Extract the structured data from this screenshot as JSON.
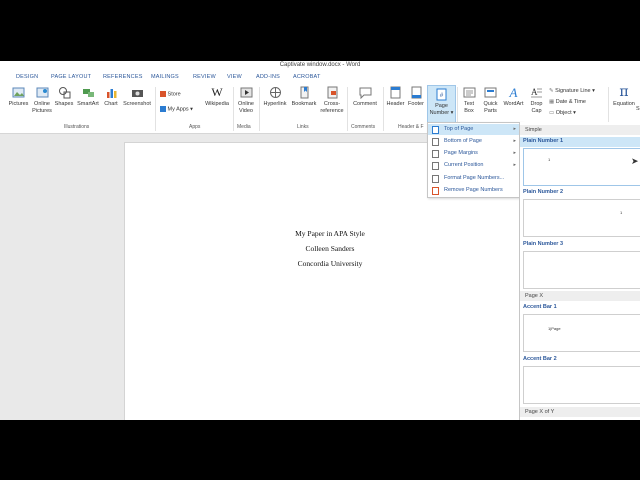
{
  "window": {
    "title": "Captivate window.docx - Word"
  },
  "tabs": [
    "DESIGN",
    "PAGE LAYOUT",
    "REFERENCES",
    "MAILINGS",
    "REVIEW",
    "VIEW",
    "ADD-INS",
    "ACROBAT"
  ],
  "ribbon": {
    "illustrations": {
      "pictures": "Pictures",
      "online_pictures": [
        "Online",
        "Pictures"
      ],
      "shapes": "Shapes",
      "smartart": "SmartArt",
      "chart": "Chart",
      "screenshot": "Screenshot",
      "label": "Illustrations"
    },
    "apps": {
      "store": "Store",
      "my_apps": "My Apps",
      "wikipedia": "Wikipedia",
      "label": "Apps"
    },
    "media": {
      "online_video": [
        "Online",
        "Video"
      ],
      "label": "Media"
    },
    "links": {
      "hyperlink": "Hyperlink",
      "bookmark": "Bookmark",
      "cross_reference": [
        "Cross-",
        "reference"
      ],
      "label": "Links"
    },
    "comments": {
      "comment": "Comment",
      "label": "Comments"
    },
    "header_footer": {
      "header": "Header",
      "footer": "Footer",
      "page_number": [
        "Page",
        "Number"
      ],
      "label": "Header & F"
    },
    "text": {
      "text_box": [
        "Text",
        "Box"
      ],
      "quick_parts": [
        "Quick",
        "Parts"
      ],
      "wordart": "WordArt",
      "drop_cap": [
        "Drop",
        "Cap"
      ],
      "signature_line": "Signature Line",
      "date_time": "Date & Time",
      "object": "Object"
    },
    "symbols": {
      "equation": "Equation",
      "equation_glyph": "π",
      "symbol_partial": "S"
    }
  },
  "page_number_menu": {
    "items": [
      {
        "label": "Top of Page",
        "submenu": true
      },
      {
        "label": "Bottom of Page",
        "submenu": true
      },
      {
        "label": "Page Margins",
        "submenu": true
      },
      {
        "label": "Current Position",
        "submenu": true
      },
      {
        "label": "Format Page Numbers...",
        "submenu": false
      },
      {
        "label": "Remove Page Numbers",
        "submenu": false
      }
    ]
  },
  "gallery": {
    "section_simple": "Simple",
    "items": [
      {
        "title": "Plain Number 1",
        "mark": "1"
      },
      {
        "title": "Plain Number 2",
        "mark": "1"
      },
      {
        "title": "Plain Number 3",
        "mark": ""
      }
    ],
    "section_page_x": "Page X",
    "accent": [
      {
        "title": "Accent Bar 1",
        "mark": "1|Page"
      },
      {
        "title": "Accent Bar 2",
        "mark": ""
      }
    ],
    "section_page_x_of_y": "Page X of Y"
  },
  "document": {
    "lines": [
      "My Paper in APA Style",
      "Colleen Sanders",
      "Concordia University"
    ]
  },
  "colors": {
    "accent": "#2b579a",
    "highlight": "#cde6f7"
  }
}
